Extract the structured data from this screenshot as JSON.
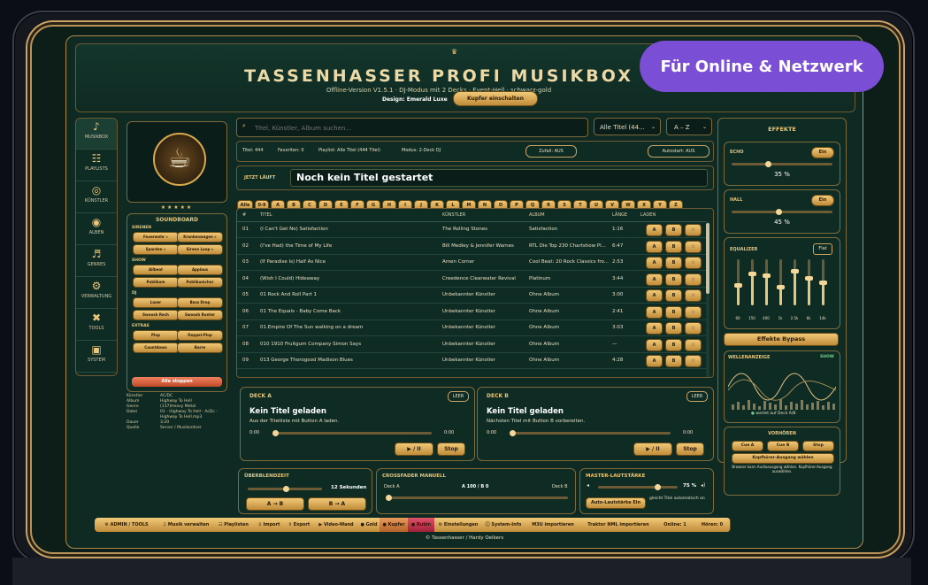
{
  "header": {
    "title": "TASSENHASSER PROFI MUSIKBOX",
    "subtitle": "Offline-Version V1.5.1 · DJ-Modus mit 2 Decks · Event-Hell · schwarz-gold",
    "design_label": "Design: Emerald Luxe",
    "copper_button": "Kupfer einschalten",
    "online_badge": "Für Online & Netzwerk"
  },
  "nav": [
    {
      "icon": "♪",
      "label": "MUSIKBOX"
    },
    {
      "icon": "☷",
      "label": "PLAYLISTS"
    },
    {
      "icon": "◎",
      "label": "KÜNSTLER"
    },
    {
      "icon": "◉",
      "label": "ALBEN"
    },
    {
      "icon": "♬",
      "label": "GENRES"
    },
    {
      "icon": "⚙",
      "label": "VERWALTUNG"
    },
    {
      "icon": "✖",
      "label": "TOOLS"
    },
    {
      "icon": "▣",
      "label": "SYSTEM"
    }
  ],
  "sidebar": {
    "stars": "★ ★ ★ ★ ★",
    "soundboard_title": "SOUNDBOARD",
    "groups": [
      {
        "head": "SIRENEN",
        "buttons": [
          "Feuerwehr »",
          "Krankenwagen »",
          "Sparden »",
          "Sirene Loop »"
        ]
      },
      {
        "head": "SHOW",
        "buttons": [
          "Allbeat",
          "Applaus",
          "Publikum",
          "Publikumchor"
        ]
      },
      {
        "head": "DJ",
        "buttons": [
          "Laser",
          "Bass Drop",
          "Swoosh Rech",
          "Swoosh Runter"
        ]
      },
      {
        "head": "EXTRAS",
        "buttons": [
          "Plop",
          "Doppel-Plop",
          "Countdown",
          "Barre"
        ]
      }
    ],
    "stop_all": "Alle stoppen",
    "info": [
      [
        "Künstler",
        "AC/DC"
      ],
      [
        "Album",
        "Highway To Hell"
      ],
      [
        "Genre",
        "(137)Heavy Metal"
      ],
      [
        "Datei",
        "01 - Highway To Hell - AcDc - Highway To Hell.mp3"
      ],
      [
        "Dauer",
        "3:20"
      ],
      [
        "Quelle",
        "Server / Musikordner"
      ]
    ]
  },
  "search": {
    "placeholder": "Titel, Künstler, Album suchen...",
    "filter": "Alle Titel (44...",
    "sort": "A – Z"
  },
  "stats": {
    "titles": "Titel: 444",
    "favs": "Favoriten: 0",
    "playlist": "Playlist: Alle Titel (444 Titel)",
    "mode": "Modus: 2-Deck DJ",
    "shuffle": "Zufall: AUS",
    "autostart": "Autostart: AUS"
  },
  "now_playing": {
    "label": "JETZT LÄUFT",
    "value": "Noch kein Titel gestartet"
  },
  "letters": [
    "Alle",
    "0-9",
    "A",
    "B",
    "C",
    "D",
    "E",
    "F",
    "G",
    "H",
    "I",
    "J",
    "K",
    "L",
    "M",
    "N",
    "O",
    "P",
    "Q",
    "R",
    "S",
    "T",
    "U",
    "V",
    "W",
    "X",
    "Y",
    "Z"
  ],
  "table": {
    "headers": [
      "#",
      "TITEL",
      "KÜNSTLER",
      "ALBUM",
      "LÄNGE",
      "LADEN"
    ],
    "rows": [
      [
        "01",
        "(I Can't Get No) Satisfaction",
        "The Rolling Stones",
        "Satisfaction",
        "1:16"
      ],
      [
        "02",
        "(I've Had) the Time of My Life",
        "Bill Medley & Jennifer Warnes",
        "RTL Die Top 230 Chartshow Pl...",
        "6:47"
      ],
      [
        "03",
        "(If Paradise Is) Half As Nice",
        "Amen Corner",
        "Cool Beat: 20 Rock Classics fro...",
        "2:53"
      ],
      [
        "04",
        "(Wish I Could) Hideaway",
        "Creedence Clearwater Revival",
        "Platinum",
        "3:44"
      ],
      [
        "05",
        "01 Rock And Roll Part 1",
        "Unbekannter Künstler",
        "Ohne Album",
        "3:00"
      ],
      [
        "06",
        "01 The Equals - Baby Come Back",
        "Unbekannter Künstler",
        "Ohne Album",
        "2:41"
      ],
      [
        "07",
        "01.Empire Of The Sun walking on a dream",
        "Unbekannter Künstler",
        "Ohne Album",
        "3:03"
      ],
      [
        "08",
        "010 1910 Fruitgum Company Simon Says",
        "Unbekannter Künstler",
        "Ohne Album",
        "—"
      ],
      [
        "09",
        "013 George Thorogood Madison Blues",
        "Unbekannter Künstler",
        "Ohne Album",
        "4:28"
      ]
    ],
    "btn_a": "A",
    "btn_b": "B",
    "btn_star": "☆"
  },
  "deckA": {
    "title": "DECK A",
    "status": "LEER",
    "heading": "Kein Titel geladen",
    "hint": "Aus der Titelliste mit Button A laden.",
    "t0": "0:00",
    "t1": "0:00",
    "play": "▶ / II",
    "stop": "Stop"
  },
  "deckB": {
    "title": "DECK B",
    "status": "LEER",
    "heading": "Kein Titel geladen",
    "hint": "Nächsten Titel mit Button B vorbereiten.",
    "t0": "0:00",
    "t1": "0:00",
    "play": "▶ / II",
    "stop": "Stop"
  },
  "crossover": {
    "title": "ÜBERBLENDZEIT",
    "value": "12 Sekunden",
    "ab": "A → B",
    "ba": "B → A"
  },
  "crossfader": {
    "title": "CROSSFADER MANUELL",
    "left": "Deck A",
    "mid": "A 100 / B 0",
    "right": "Deck B"
  },
  "master": {
    "title": "MASTER-LAUTSTÄRKE",
    "value": "75 %",
    "auto": "Auto-Lautstärke Ein",
    "note": "gleicht Titel automatisch an"
  },
  "effects": {
    "title": "EFFEKTE",
    "echo": "ECHO",
    "echo_val": "35 %",
    "hall": "HALL",
    "hall_val": "45 %",
    "on": "Ein",
    "eq": "EQUALIZER",
    "flat": "Flat",
    "eq_bands": [
      "60",
      "150",
      "400",
      "1k",
      "2.5k",
      "6k",
      "14k"
    ],
    "bypass": "Effekte Bypass",
    "wave": "WELLENANZEIGE",
    "show": "SHOW",
    "wave_note": "wartet auf Deck A/B",
    "vorhoren": "VORHÖREN",
    "cue_a": "Cue A",
    "cue_b": "Cue B",
    "stop": "Stop",
    "kopf": "Kopfhörer-Ausgang wählen",
    "kopf_note": "Browser kann Audioausgang wählen. Kopfhörer-Ausgang auswählen."
  },
  "footer": {
    "buttons": [
      "⚙ ADMIN / TOOLS",
      "♫ Musik verwalten",
      "☷ Playlisten",
      "⇩ Import",
      "⇧ Export",
      "▶ Video-Wand",
      "● Gold",
      "● Kupfer",
      "● Rubin",
      "⚙ Einstellungen",
      "ⓘ System-Info",
      "M3U importieren",
      "Traktor NML importieren",
      "Online: 1",
      "Hören: 0"
    ],
    "copyright": "© Tassenhasser / Hardy Oelkers"
  }
}
